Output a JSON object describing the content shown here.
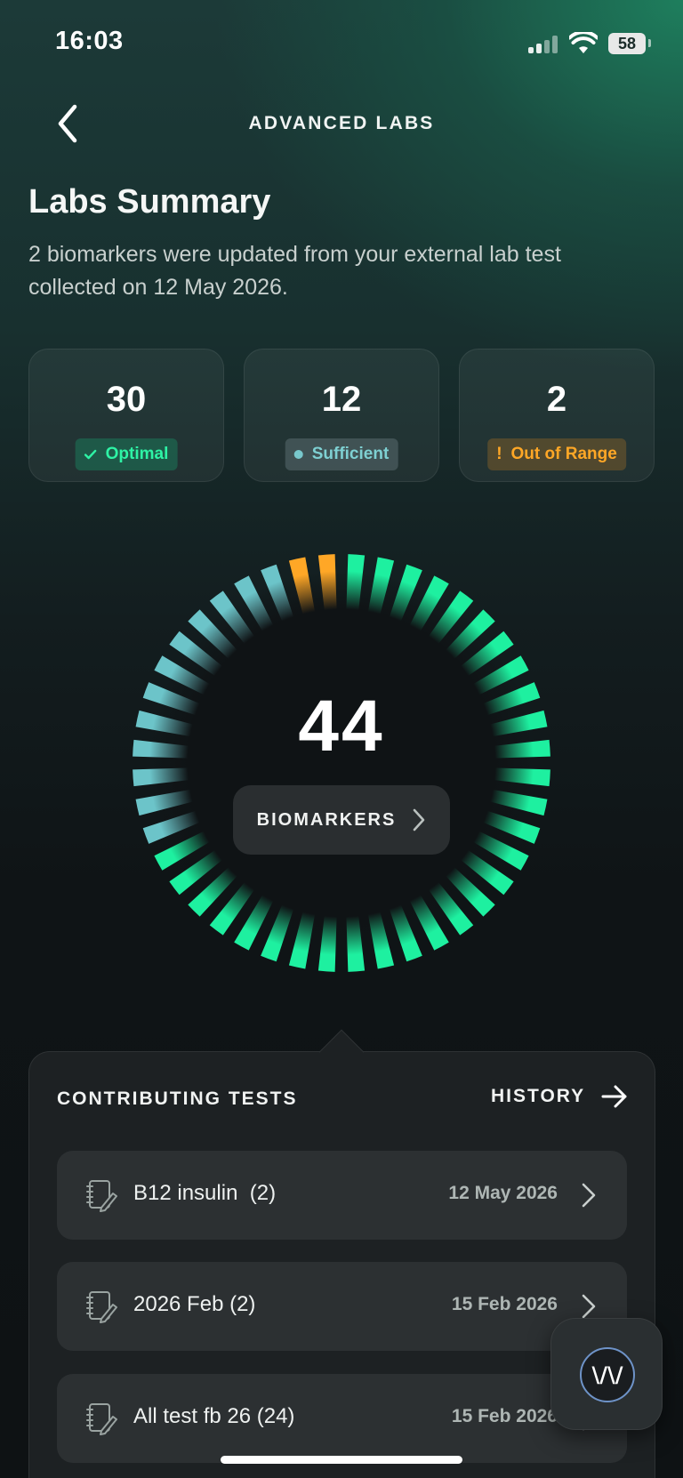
{
  "status_bar": {
    "time": "16:03",
    "battery": "58"
  },
  "nav": {
    "title": "ADVANCED LABS",
    "back_icon": "chevron-left-icon"
  },
  "summary": {
    "title": "Labs Summary",
    "subtitle": "2 biomarkers were updated from your external lab test collected on 12 May 2026."
  },
  "stats": [
    {
      "value": "30",
      "label": "Optimal",
      "icon": "check-icon",
      "color": "#2ef3a5"
    },
    {
      "value": "12",
      "label": "Sufficient",
      "icon": "dot-icon",
      "color": "#78c8cc"
    },
    {
      "value": "2",
      "label": "Out of Range",
      "icon": "exclamation-icon",
      "color": "#ffa726"
    }
  ],
  "ring": {
    "total": "44",
    "button_label": "BIOMARKERS",
    "colors": {
      "optimal": "#1ef0a0",
      "sufficient": "#6cc4c9",
      "out_of_range": "#ffa726"
    }
  },
  "contributing": {
    "title": "CONTRIBUTING TESTS",
    "history_label": "HISTORY",
    "tests": [
      {
        "name": "B12 insulin  (2)",
        "date": "12 May 2026"
      },
      {
        "name": "2026 Feb (2)",
        "date": "15 Feb 2026"
      },
      {
        "name": "All test fb 26 (24)",
        "date": "15 Feb 2026"
      }
    ]
  },
  "fab": {
    "label": "\\/\\/"
  }
}
